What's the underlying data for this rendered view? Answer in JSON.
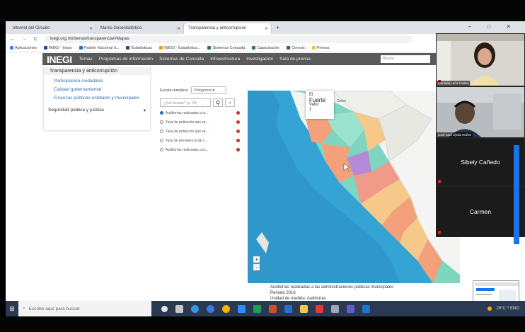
{
  "browser": {
    "tabs": [
      {
        "title": "Internet del Circuito"
      },
      {
        "title": "Marco Geoestadístico"
      },
      {
        "title": "Transparencia y anticorrupción",
        "active": true
      }
    ],
    "new_tab": "+",
    "window_controls": "–  □  ✕",
    "nav_buttons": "← → C",
    "url": "inegi.org.mx/temas/transparencia/#Mapas",
    "bookmarks": [
      "Aplicaciones",
      "INEGI - Inicio",
      "Padrón Nacional d...",
      "Estadísticas",
      "INEGI - Estadística...",
      "Sistemas Consulta",
      "Capacitación",
      "Censos",
      "Prensa"
    ]
  },
  "inegi": {
    "logo": "INEGI",
    "menu": [
      "Temas",
      "Programas de información",
      "Sistemas de Consulta",
      "Infraestructura",
      "Investigación",
      "Sala de prensa"
    ],
    "search_placeholder": "Buscar..."
  },
  "side_menu": {
    "header": "Transparencia y anticorrupción",
    "items": [
      "Participación ciudadana",
      "Calidad gubernamental",
      "Finanzas públicas estatales y municipales"
    ],
    "section": "Seguridad pública y justicia",
    "section_icon": "▾"
  },
  "layers": {
    "scale_label": "Escala temática:",
    "scale_value": "Polígonos",
    "search_placeholder": "¿Qué buscas? (p. 20)",
    "search_btn": "Q",
    "collapse_btn": "‹",
    "items": [
      {
        "label": "Auditorías realizadas a la...",
        "checked": true
      },
      {
        "label": "Tasa de población que se...",
        "checked": false
      },
      {
        "label": "Tasa de población que se...",
        "checked": false
      },
      {
        "label": "Tasa de prevalencia de c...",
        "checked": false
      },
      {
        "label": "Auditorías realizadas a la...",
        "checked": false
      }
    ]
  },
  "map_popup": {
    "line1": "El",
    "line2": "Fuerte",
    "line3": "Valor",
    "line4": "2",
    "side": "Datos"
  },
  "map_caption": {
    "title": "Auditorías realizadas a las administraciones públicas municipales",
    "subtitle": "Periodo 2016",
    "line3": "Unidad de medida: Auditorías"
  },
  "participants": [
    {
      "name": "Marisela León Fontes",
      "type": "video"
    },
    {
      "name": "José Saúl Ojeda Nuñez",
      "type": "video"
    },
    {
      "name": "Sibely Cañedo",
      "type": "name"
    },
    {
      "name": "Carmen",
      "type": "name"
    }
  ],
  "taskbar": {
    "start_icon": "windows-icon",
    "search_placeholder": "Escribe aquí para buscar",
    "tray_text": "29°C  ^  ENG"
  },
  "colors": {
    "inegi_header": "#5a5a5a",
    "link": "#2a6fb4",
    "taskbar": "#2b3a52",
    "sea": "#35a3d4"
  }
}
